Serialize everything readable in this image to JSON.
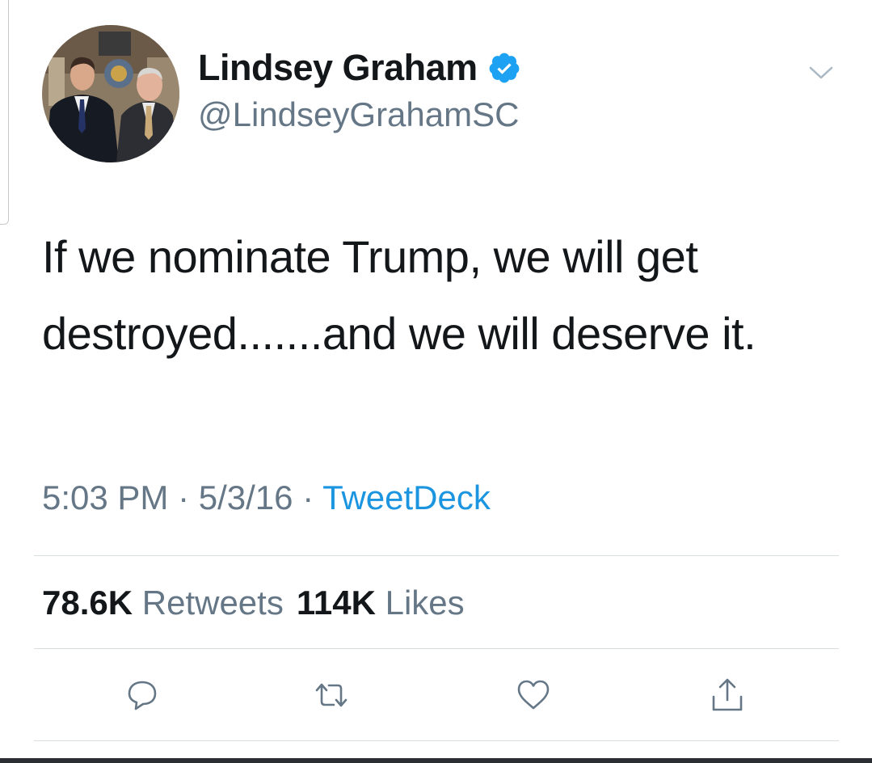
{
  "user": {
    "display_name": "Lindsey Graham",
    "handle": "@LindseyGrahamSC",
    "verified": true,
    "avatar": "profile-photo"
  },
  "tweet": {
    "text": "If we nominate Trump, we will get destroyed.......and we will deserve it."
  },
  "meta": {
    "time": "5:03 PM",
    "separator": " · ",
    "date": "5/3/16",
    "source": "TweetDeck"
  },
  "stats": {
    "retweets_count": "78.6K",
    "retweets_label": "Retweets",
    "likes_count": "114K",
    "likes_label": "Likes"
  },
  "actions": [
    {
      "icon": "reply-icon"
    },
    {
      "icon": "retweet-icon"
    },
    {
      "icon": "like-icon"
    },
    {
      "icon": "share-icon"
    }
  ],
  "colors": {
    "text": "#14171a",
    "secondary": "#657786",
    "link": "#1b95e0",
    "verified": "#1da1f2",
    "divider": "#d8dde0"
  }
}
